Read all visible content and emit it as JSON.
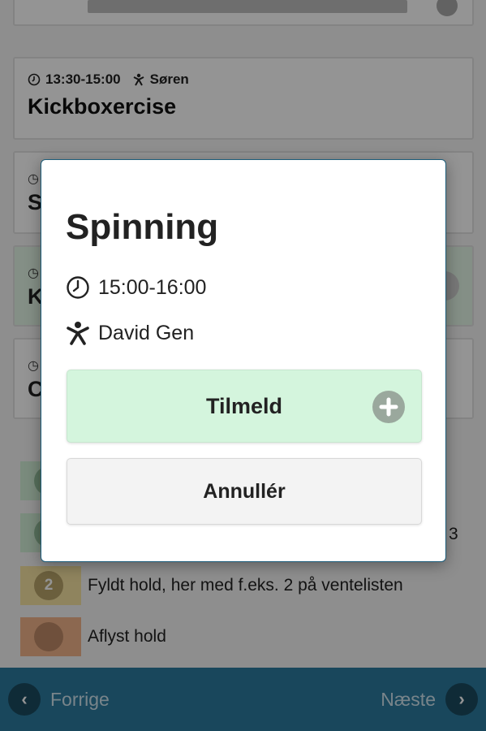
{
  "background": {
    "classes": [
      {
        "time": "13:30-15:00",
        "coach": "Søren",
        "title": "Kickboxercise"
      },
      {
        "stub_letter": "S"
      },
      {
        "stub_letter": "K"
      },
      {
        "stub_letter": "C"
      }
    ],
    "legend": [
      {
        "text": ""
      },
      {
        "text": "",
        "tail": "3"
      },
      {
        "badge": "2",
        "text": "Fyldt hold, her med f.eks. 2 på ventelisten"
      },
      {
        "text": "Aflyst hold"
      }
    ],
    "nav": {
      "prev_label": "Forrige",
      "next_label": "Næste"
    }
  },
  "modal": {
    "title": "Spinning",
    "time": "15:00-16:00",
    "coach": "David Gen",
    "signup_label": "Tilmeld",
    "cancel_label": "Annullér"
  },
  "colors": {
    "signup_bg": "#d4f5dd",
    "nav_bar": "#2b7b9f",
    "modal_border": "#1d5d7a"
  },
  "icons": [
    "clock-icon",
    "person-icon",
    "plus-icon",
    "chevron-left-icon",
    "chevron-right-icon",
    "cancel-icon"
  ]
}
